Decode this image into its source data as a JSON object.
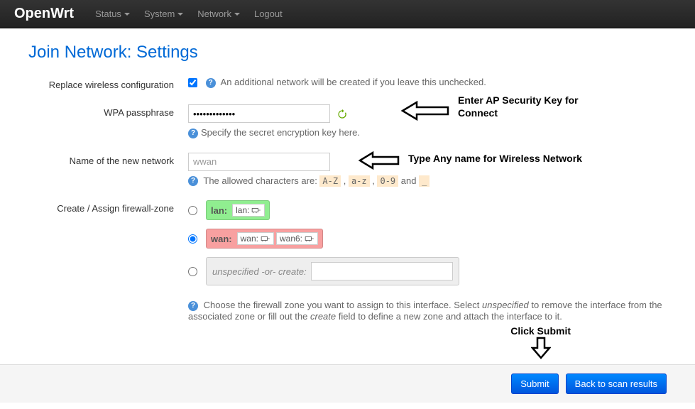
{
  "navbar": {
    "brand": "OpenWrt",
    "items": [
      "Status",
      "System",
      "Network",
      "Logout"
    ]
  },
  "page_title": "Join Network: Settings",
  "fields": {
    "replace": {
      "label": "Replace wireless configuration",
      "help": "An additional network will be created if you leave this unchecked."
    },
    "passphrase": {
      "label": "WPA passphrase",
      "value": "•••••••••••••",
      "help": "Specify the secret encryption key here."
    },
    "netname": {
      "label": "Name of the new network",
      "value": "wwan",
      "help_prefix": "The allowed characters are: ",
      "codes": [
        "A-Z",
        "a-z",
        "0-9",
        "_"
      ],
      "help_and": " and "
    },
    "firewall": {
      "label": "Create / Assign firewall-zone",
      "zones": {
        "lan": {
          "label": "lan:",
          "ifaces": [
            "lan:"
          ]
        },
        "wan": {
          "label": "wan:",
          "ifaces": [
            "wan:",
            "wan6:"
          ]
        },
        "unspec": "unspecified -or- create:"
      },
      "help_1": "Choose the firewall zone you want to assign to this interface. Select ",
      "help_em1": "unspecified",
      "help_2": " to remove the interface from the associated zone or fill out the ",
      "help_em2": "create",
      "help_3": " field to define a new zone and attach the interface to it."
    }
  },
  "annotations": {
    "passphrase": "Enter AP Security Key for Connect",
    "netname": "Type Any name for Wireless  Network",
    "submit": "Click Submit"
  },
  "buttons": {
    "submit": "Submit",
    "back": "Back to scan results"
  }
}
